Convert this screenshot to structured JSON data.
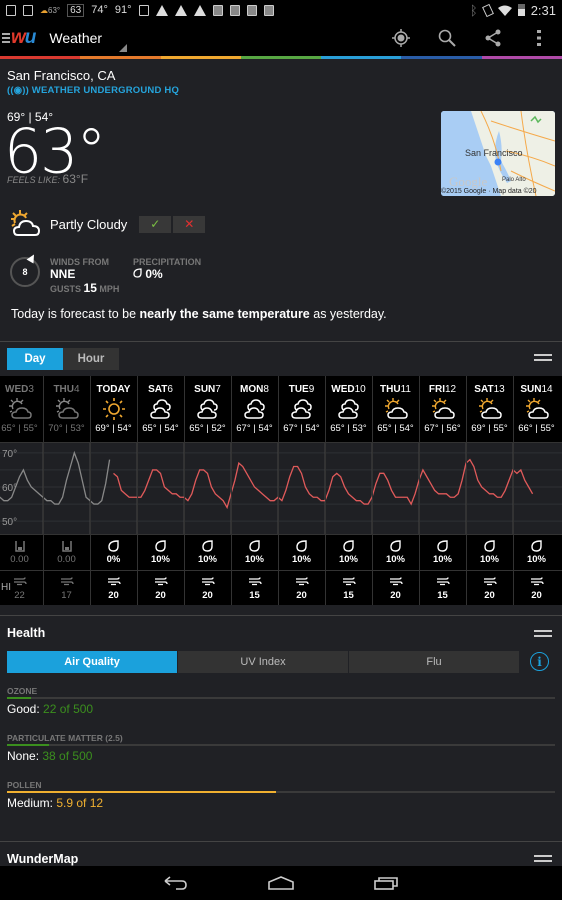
{
  "status_bar": {
    "notification_icons": [
      "download-icon",
      "download-icon",
      "weather-icon",
      "temp-63",
      "temp-74",
      "temp-91",
      "image-icon",
      "alert-icon",
      "alert-icon",
      "alert-icon",
      "briefcase-check-icon",
      "briefcase-play-icon",
      "briefcase-check-icon",
      "briefcase-check-icon"
    ],
    "notif_temp_small": "63°",
    "notif_temp_box": "63",
    "notif_temp_2": "74°",
    "notif_temp_3": "91°",
    "time": "2:31"
  },
  "app_bar": {
    "title": "Weather",
    "actions": [
      "locate-icon",
      "search-icon",
      "share-icon",
      "overflow-menu-icon"
    ]
  },
  "accent_colors": [
    "#d93a30",
    "#e47a2c",
    "#f0a830",
    "#58a743",
    "#2a9fd8",
    "#2a5da8",
    "#b04aa8"
  ],
  "location": {
    "city": "San Francisco, CA",
    "station": "WEATHER UNDERGROUND HQ"
  },
  "current": {
    "hilo": "69° | 54°",
    "temp": "63°",
    "feels_like_label": "FEELS LIKE:",
    "feels_like_value": "63°F",
    "condition": "Partly Cloudy",
    "agree": "✓",
    "disagree": "✕",
    "wind_label": "WINDS FROM",
    "wind_speed": "8",
    "wind_dir": "NNE",
    "gusts_label": "GUSTS",
    "gusts_value": "15",
    "gusts_unit": "MPH",
    "precip_label": "PRECIPITATION",
    "precip_value": "0%",
    "summary_pre": "Today is forecast to be ",
    "summary_bold": "nearly the same temperature",
    "summary_post": " as yesterday."
  },
  "map": {
    "label_city": "San Francisco",
    "label_town": "Palo Alto",
    "attribution": "©2015 Google · Map data ©20",
    "watermark": "Google"
  },
  "forecast_tabs": {
    "day": "Day",
    "hour": "Hour"
  },
  "forecast": {
    "days": [
      {
        "name": "WED",
        "num": "3",
        "hilo": "65° | 55°",
        "icon": "partly-cloudy",
        "past": true,
        "precip": "0.00",
        "precip_icon": "rain-gauge",
        "wind": "22"
      },
      {
        "name": "THU",
        "num": "4",
        "hilo": "70° | 53°",
        "icon": "partly-cloudy",
        "past": true,
        "precip": "0.00",
        "precip_icon": "rain-gauge",
        "wind": "17"
      },
      {
        "name": "TODAY",
        "num": "",
        "hilo": "69° | 54°",
        "icon": "sunny",
        "past": false,
        "precip": "0%",
        "precip_icon": "drop",
        "wind": "20"
      },
      {
        "name": "SAT",
        "num": "6",
        "hilo": "65° | 54°",
        "icon": "cloudy",
        "past": false,
        "precip": "10%",
        "precip_icon": "drop",
        "wind": "20"
      },
      {
        "name": "SUN",
        "num": "7",
        "hilo": "65° | 52°",
        "icon": "cloudy",
        "past": false,
        "precip": "10%",
        "precip_icon": "drop",
        "wind": "20"
      },
      {
        "name": "MON",
        "num": "8",
        "hilo": "67° | 54°",
        "icon": "cloudy",
        "past": false,
        "precip": "10%",
        "precip_icon": "drop",
        "wind": "15"
      },
      {
        "name": "TUE",
        "num": "9",
        "hilo": "67° | 54°",
        "icon": "cloudy",
        "past": false,
        "precip": "10%",
        "precip_icon": "drop",
        "wind": "20"
      },
      {
        "name": "WED",
        "num": "10",
        "hilo": "65° | 53°",
        "icon": "cloudy",
        "past": false,
        "precip": "10%",
        "precip_icon": "drop",
        "wind": "15"
      },
      {
        "name": "THU",
        "num": "11",
        "hilo": "65° | 54°",
        "icon": "partly-cloudy",
        "past": false,
        "precip": "10%",
        "precip_icon": "drop",
        "wind": "20"
      },
      {
        "name": "FRI",
        "num": "12",
        "hilo": "67° | 56°",
        "icon": "partly-cloudy",
        "past": false,
        "precip": "10%",
        "precip_icon": "drop",
        "wind": "15"
      },
      {
        "name": "SAT",
        "num": "13",
        "hilo": "69° | 55°",
        "icon": "partly-cloudy",
        "past": false,
        "precip": "10%",
        "precip_icon": "drop",
        "wind": "20"
      },
      {
        "name": "SUN",
        "num": "14",
        "hilo": "66° | 55°",
        "icon": "partly-cloudy",
        "past": false,
        "precip": "10%",
        "precip_icon": "drop",
        "wind": "20"
      }
    ],
    "wind_row_label": "HI"
  },
  "chart_data": {
    "type": "line",
    "title": "",
    "xlabel": "",
    "ylabel": "",
    "y_ticks": [
      "70°",
      "60°",
      "50°"
    ],
    "ylim": [
      48,
      72
    ],
    "series": [
      {
        "name": "past",
        "color": "#888888",
        "days": [
          [
            58,
            57,
            56,
            56,
            57,
            60,
            63,
            65,
            62,
            60,
            59,
            58
          ],
          [
            57,
            56,
            56,
            55,
            55,
            57,
            62,
            66,
            70,
            67,
            62,
            57
          ],
          [
            56,
            55,
            55,
            56,
            61,
            68
          ]
        ]
      },
      {
        "name": "forecast",
        "color": "#e05a5a",
        "days": [
          [
            64,
            63,
            59,
            58,
            57,
            57
          ],
          [
            57,
            57,
            59,
            62,
            65,
            65,
            64,
            60,
            59,
            58,
            58,
            57
          ],
          [
            57,
            56,
            58,
            62,
            65,
            65,
            64,
            60,
            58,
            57,
            56,
            54
          ],
          [
            58,
            62,
            67,
            66,
            64,
            62,
            60,
            59,
            58,
            57,
            56,
            56
          ],
          [
            57,
            56,
            59,
            63,
            66,
            66,
            64,
            60,
            58,
            57,
            57,
            56
          ],
          [
            56,
            59,
            63,
            64,
            63,
            60,
            58,
            57,
            56,
            56,
            55,
            55
          ],
          [
            57,
            61,
            64,
            64,
            62,
            59,
            57,
            57,
            57,
            57,
            55,
            58
          ],
          [
            62,
            65,
            63,
            61,
            59,
            58,
            58,
            58,
            57,
            57,
            58,
            62
          ],
          [
            67,
            68,
            66,
            62,
            60,
            59,
            58,
            58,
            57,
            57,
            59,
            62
          ],
          [
            65,
            64,
            65,
            62,
            60,
            58
          ]
        ]
      }
    ]
  },
  "health": {
    "title": "Health",
    "tabs": [
      "Air Quality",
      "UV Index",
      "Flu"
    ],
    "active_tab": 0,
    "metrics": [
      {
        "label": "OZONE",
        "status": "Good:",
        "value": "22 of 500",
        "fraction": 0.044,
        "color": "#3b8f1e"
      },
      {
        "label": "PARTICULATE MATTER (2.5)",
        "status": "None:",
        "value": "38 of 500",
        "fraction": 0.076,
        "color": "#3b8f1e"
      },
      {
        "label": "POLLEN",
        "status": "Medium:",
        "value": "5.9 of 12",
        "fraction": 0.49,
        "color": "#f0b030"
      }
    ]
  },
  "wundermap": {
    "title": "WunderMap"
  },
  "nav_bar": [
    "back-icon",
    "home-icon",
    "recents-icon"
  ]
}
